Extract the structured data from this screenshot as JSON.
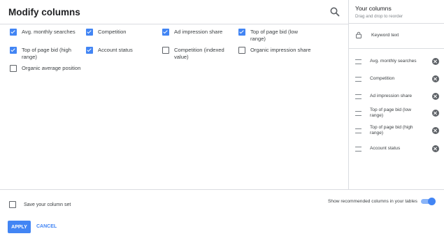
{
  "title": "Modify columns",
  "options": [
    {
      "label": "Avg. monthly searches",
      "checked": true
    },
    {
      "label": "Competition",
      "checked": true
    },
    {
      "label": "Ad impression share",
      "checked": true
    },
    {
      "label": "Top of page bid (low range)",
      "checked": true
    },
    {
      "label": "Top of page bid (high range)",
      "checked": true
    },
    {
      "label": "Account status",
      "checked": true
    },
    {
      "label": "Competition (indexed value)",
      "checked": false
    },
    {
      "label": "Organic impression share",
      "checked": false
    },
    {
      "label": "Organic average position",
      "checked": false
    }
  ],
  "sidebar": {
    "title": "Your columns",
    "subtitle": "Drag and drop to reorder",
    "locked": "Keyword text",
    "columns": [
      "Avg. monthly searches",
      "Competition",
      "Ad impression share",
      "Top of page bid (low range)",
      "Top of page bid (high range)",
      "Account status"
    ]
  },
  "footer": {
    "save_label": "Save your column set",
    "save_checked": false,
    "recommended_label": "Show recommended columns in your tables",
    "recommended_on": true,
    "apply_label": "APPLY",
    "cancel_label": "CANCEL"
  },
  "colors": {
    "accent": "#4285f4"
  },
  "icons": {
    "search": "search-icon",
    "lock": "lock-icon",
    "drag": "drag-handle-icon",
    "remove": "remove-circle-icon"
  }
}
